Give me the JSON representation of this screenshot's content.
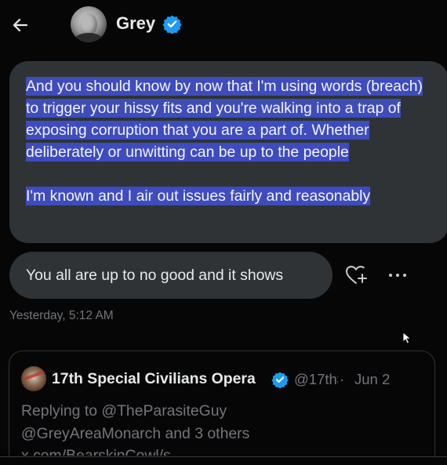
{
  "header": {
    "display_name": "Grey",
    "back_icon": "arrow-left-icon",
    "verified_icon": "verified-badge-icon"
  },
  "messages": [
    {
      "paragraphs": [
        "And you should know by now that I'm using words (breach) to trigger your hissy fits and you're walking into a trap of exposing corruption that you are a part of. Whether deliberately or unwitting can be up to the people",
        "I'm known and I air out issues fairly and reasonably"
      ],
      "selected": true
    },
    {
      "text": "You all are up to no good and it shows"
    }
  ],
  "message_actions": {
    "react_icon": "heart-plus-icon",
    "more_icon": "more-dots-icon"
  },
  "timestamp": "Yesterday, 5:12 AM",
  "quoted_post": {
    "author_name": "17th Special Civilians Opera",
    "handle": "@17th$",
    "separator": "·",
    "date": "Jun 2",
    "replying_to_line1": "Replying to @TheParasiteGuy",
    "replying_to_line2": "@GreyAreaMonarch and 3 others",
    "link_text": "x.com/BearskinCowl/s..."
  },
  "colors": {
    "background": "#060606",
    "bubble": "#2f3336",
    "selection": "#3e4cbd",
    "verified": "#1d9bf0",
    "muted_text": "#71767b"
  }
}
